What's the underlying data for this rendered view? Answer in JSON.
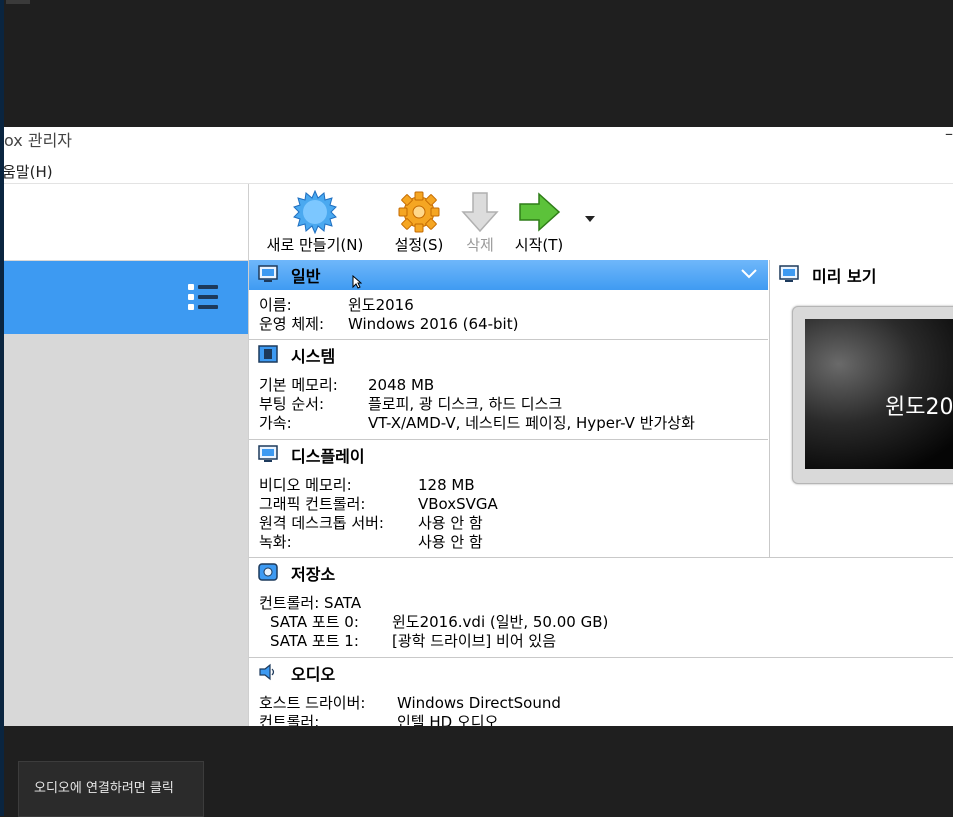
{
  "window": {
    "title": "ox 관리자",
    "menu_help": "움말(H)"
  },
  "toolbar": {
    "new_label": "새로 만들기(N)",
    "settings_label": "설정(S)",
    "delete_label": "삭제",
    "start_label": "시작(T)"
  },
  "general": {
    "title": "일반",
    "rows": [
      {
        "k": "이름:",
        "v": "윈도2016"
      },
      {
        "k": "운영 체제:",
        "v": "Windows 2016 (64-bit)"
      }
    ]
  },
  "system": {
    "title": "시스템",
    "rows": [
      {
        "k": "기본 메모리:",
        "v": "2048 MB"
      },
      {
        "k": "부팅 순서:",
        "v": "플로피, 광 디스크, 하드 디스크"
      },
      {
        "k": "가속:",
        "v": "VT-X/AMD-V, 네스티드 페이징, Hyper-V 반가상화"
      }
    ]
  },
  "display": {
    "title": "디스플레이",
    "rows": [
      {
        "k": "비디오 메모리:",
        "v": "128 MB"
      },
      {
        "k": "그래픽 컨트롤러:",
        "v": "VBoxSVGA"
      },
      {
        "k": "원격 데스크톱 서버:",
        "v": "사용 안 함"
      },
      {
        "k": "녹화:",
        "v": "사용 안 함"
      }
    ]
  },
  "storage": {
    "title": "저장소",
    "controller": "컨트롤러: SATA",
    "rows": [
      {
        "k": "SATA 포트 0:",
        "v": "윈도2016.vdi (일반, 50.00 GB)"
      },
      {
        "k": "SATA 포트 1:",
        "v": "[광학 드라이브] 비어 있음"
      }
    ]
  },
  "audio": {
    "title": "오디오",
    "rows": [
      {
        "k": "호스트 드라이버:",
        "v": "Windows DirectSound"
      },
      {
        "k": "컨트롤러:",
        "v": "인텔 HD 오디오"
      }
    ]
  },
  "preview": {
    "title": "미리 보기",
    "screen_text": "윈도20"
  },
  "toast": {
    "text": "오디오에 연결하려면 클릭"
  },
  "colors": {
    "accent": "#3d9af2",
    "background": "#1f1f1f"
  }
}
